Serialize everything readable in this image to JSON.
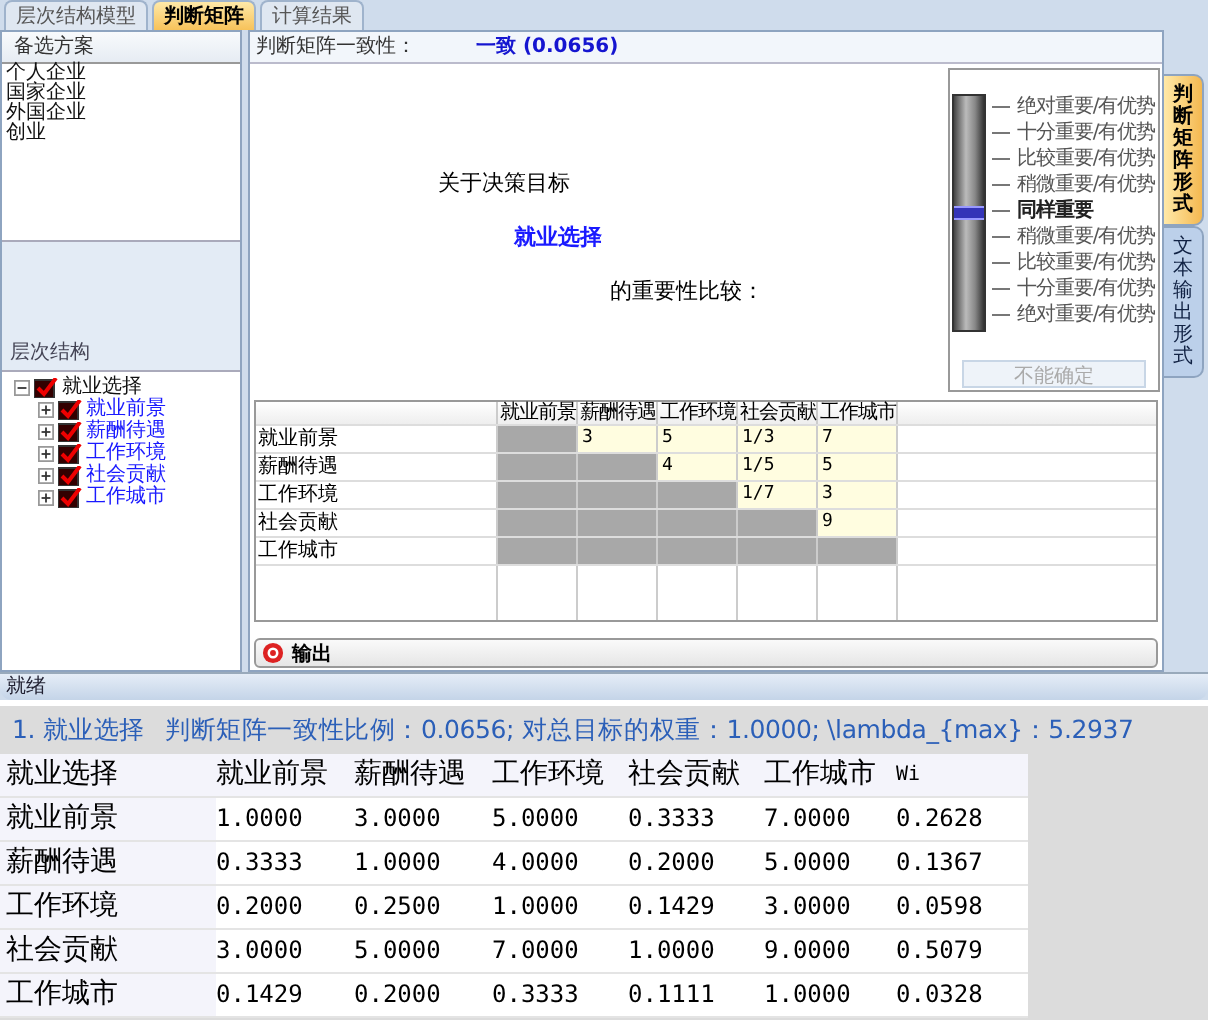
{
  "tabs": [
    {
      "label": "层次结构模型",
      "selected": false
    },
    {
      "label": "判断矩阵",
      "selected": true
    },
    {
      "label": "计算结果",
      "selected": false
    }
  ],
  "alternatives": {
    "title": "备选方案",
    "items": [
      "个人企业",
      "国家企业",
      "外国企业",
      "创业"
    ]
  },
  "hierarchy": {
    "title": "层次结构",
    "tree": [
      {
        "label": "就业选择",
        "checked": true,
        "expanded": true,
        "children": [
          {
            "label": "就业前景",
            "checked": true,
            "expanded": false
          },
          {
            "label": "薪酬待遇",
            "checked": true,
            "expanded": false
          },
          {
            "label": "工作环境",
            "checked": true,
            "expanded": false
          },
          {
            "label": "社会贡献",
            "checked": true,
            "expanded": false
          },
          {
            "label": "工作城市",
            "checked": true,
            "expanded": false
          }
        ]
      }
    ]
  },
  "consistency": {
    "label": "判断矩阵一致性：",
    "value": "一致 (0.0656)"
  },
  "prompt": {
    "line_1": "关于决策目标",
    "goal": "就业选择",
    "line_2": "的重要性比较："
  },
  "scale": {
    "level": 0.5,
    "labels": [
      {
        "text": "绝对重要/有优势",
        "selected": false
      },
      {
        "text": "十分重要/有优势",
        "selected": false
      },
      {
        "text": "比较重要/有优势",
        "selected": false
      },
      {
        "text": "稍微重要/有优势",
        "selected": false
      },
      {
        "text": "同样重要",
        "selected": true
      },
      {
        "text": "稍微重要/有优势",
        "selected": false
      },
      {
        "text": "比较重要/有优势",
        "selected": false
      },
      {
        "text": "十分重要/有优势",
        "selected": false
      },
      {
        "text": "绝对重要/有优势",
        "selected": false
      }
    ],
    "button": {
      "label": "不能确定",
      "disabled": true
    }
  },
  "matrix": {
    "columns": [
      "就业前景",
      "薪酬待遇",
      "工作环境",
      "社会贡献",
      "工作城市"
    ],
    "rows": [
      {
        "label": "就业前景",
        "cells": [
          {
            "kind": "locked"
          },
          {
            "kind": "input",
            "value": "3"
          },
          {
            "kind": "input",
            "value": "5"
          },
          {
            "kind": "input",
            "value": "1/3"
          },
          {
            "kind": "input",
            "value": "7"
          }
        ]
      },
      {
        "label": "薪酬待遇",
        "cells": [
          {
            "kind": "locked"
          },
          {
            "kind": "locked"
          },
          {
            "kind": "input",
            "value": "4"
          },
          {
            "kind": "input",
            "value": "1/5"
          },
          {
            "kind": "input",
            "value": "5"
          }
        ]
      },
      {
        "label": "工作环境",
        "cells": [
          {
            "kind": "locked"
          },
          {
            "kind": "locked"
          },
          {
            "kind": "locked"
          },
          {
            "kind": "input",
            "value": "1/7"
          },
          {
            "kind": "input",
            "value": "3"
          }
        ]
      },
      {
        "label": "社会贡献",
        "cells": [
          {
            "kind": "locked"
          },
          {
            "kind": "locked"
          },
          {
            "kind": "locked"
          },
          {
            "kind": "locked"
          },
          {
            "kind": "input",
            "value": "9"
          }
        ]
      },
      {
        "label": "工作城市",
        "cells": [
          {
            "kind": "locked"
          },
          {
            "kind": "locked"
          },
          {
            "kind": "locked"
          },
          {
            "kind": "locked"
          },
          {
            "kind": "locked"
          }
        ]
      }
    ]
  },
  "output_bar": {
    "label": "输出"
  },
  "side_tabs": [
    {
      "label": "判断矩阵形式",
      "selected": true
    },
    {
      "label": "文本输出形式",
      "selected": false
    }
  ],
  "status_bar": "就绪",
  "result": {
    "title": "1. 就业选择",
    "summary": "判断矩阵一致性比例：0.0656; 对总目标的权重：1.0000; \\lambda_{max}：5.2937",
    "columns": [
      "就业选择",
      "就业前景",
      "薪酬待遇",
      "工作环境",
      "社会贡献",
      "工作城市",
      "Wi"
    ],
    "rows": [
      {
        "label": "就业前景",
        "values": [
          "1.0000",
          "3.0000",
          "5.0000",
          "0.3333",
          "7.0000",
          "0.2628"
        ]
      },
      {
        "label": "薪酬待遇",
        "values": [
          "0.3333",
          "1.0000",
          "4.0000",
          "0.2000",
          "5.0000",
          "0.1367"
        ]
      },
      {
        "label": "工作环境",
        "values": [
          "0.2000",
          "0.2500",
          "1.0000",
          "0.1429",
          "3.0000",
          "0.0598"
        ]
      },
      {
        "label": "社会贡献",
        "values": [
          "3.0000",
          "5.0000",
          "7.0000",
          "1.0000",
          "9.0000",
          "0.5079"
        ]
      },
      {
        "label": "工作城市",
        "values": [
          "0.1429",
          "0.2000",
          "0.3333",
          "0.1111",
          "1.0000",
          "0.0328"
        ]
      }
    ]
  }
}
